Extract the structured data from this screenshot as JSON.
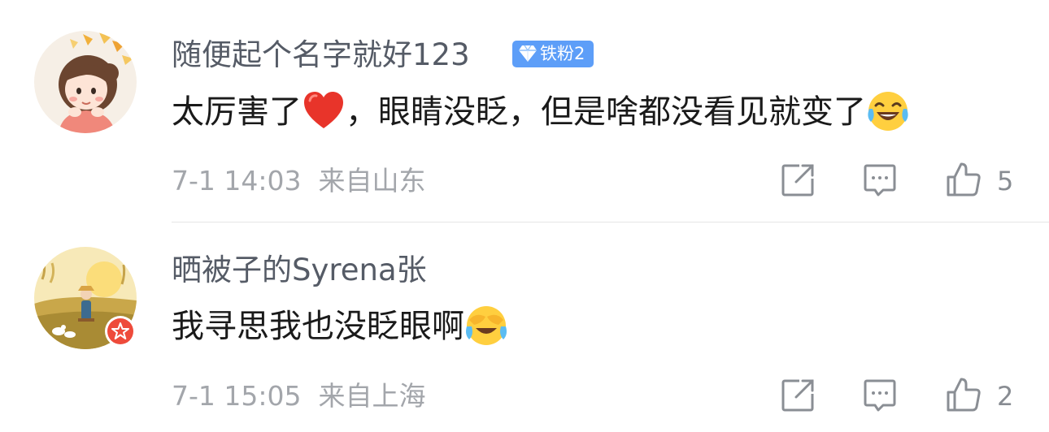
{
  "comments": [
    {
      "username": "随便起个名字就好123",
      "fan_badge": "铁粉2",
      "text_before": "太厉害了",
      "text_after": "，眼睛没眨，但是啥都没看见就变了",
      "emoji_inline": "heart-emoji",
      "emoji_end": "laughing-tears-emoji",
      "time": "7-1 14:03",
      "location": "来自山东",
      "likes": "5"
    },
    {
      "username": "晒被子的Syrena张",
      "text": "我寻思我也没眨眼啊",
      "emoji_end": "cover-face-emoji",
      "time": "7-1 15:05",
      "location": "来自上海",
      "likes": "2",
      "verified_badge": true
    }
  ],
  "icons": {
    "forward": "share-icon",
    "comment": "comment-icon",
    "like": "thumbs-up-icon"
  },
  "colors": {
    "fan_badge": "#5d9ef8",
    "verified": "#ee4b3b",
    "username": "#555b66",
    "meta": "#a3a6ab"
  }
}
